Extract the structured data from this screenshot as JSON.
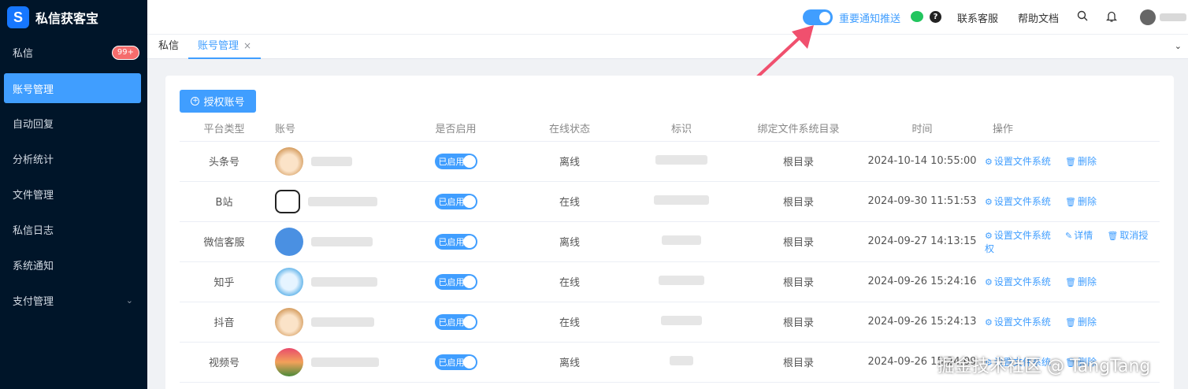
{
  "brand": {
    "name": "私信获客宝",
    "logo": "S"
  },
  "sidebar": {
    "items": [
      {
        "label": "私信",
        "badge": "99+"
      },
      {
        "label": "账号管理",
        "active": true
      },
      {
        "label": "自动回复"
      },
      {
        "label": "分析统计"
      },
      {
        "label": "文件管理"
      },
      {
        "label": "私信日志"
      },
      {
        "label": "系统通知"
      },
      {
        "label": "支付管理",
        "expandable": true
      }
    ]
  },
  "header": {
    "notify_label": "重要通知推送",
    "notify_on": true,
    "help_glyph": "?",
    "contact_label": "联系客服",
    "docs_label": "帮助文档"
  },
  "tabs": {
    "items": [
      {
        "label": "私信"
      },
      {
        "label": "账号管理",
        "active": true,
        "close": "×"
      }
    ]
  },
  "toolbar": {
    "auth_label": "授权账号",
    "auth_icon": "+"
  },
  "table": {
    "columns": [
      "平台类型",
      "账号",
      "是否启用",
      "在线状态",
      "标识",
      "绑定文件系统目录",
      "时间",
      "操作"
    ],
    "enabled_label": "已启用",
    "rows": [
      {
        "platform": "头条号",
        "status": "离线",
        "dir": "根目录",
        "time": "2024-10-14 10:55:00",
        "actions": [
          "设置文件系统",
          "删除"
        ]
      },
      {
        "platform": "B站",
        "status": "在线",
        "dir": "根目录",
        "time": "2024-09-30 11:51:53",
        "actions": [
          "设置文件系统",
          "删除"
        ]
      },
      {
        "platform": "微信客服",
        "status": "离线",
        "dir": "根目录",
        "time": "2024-09-27 14:13:15",
        "actions": [
          "设置文件系统",
          "详情",
          "取消授权"
        ]
      },
      {
        "platform": "知乎",
        "status": "在线",
        "dir": "根目录",
        "time": "2024-09-26 15:24:16",
        "actions": [
          "设置文件系统",
          "删除"
        ]
      },
      {
        "platform": "抖音",
        "status": "在线",
        "dir": "根目录",
        "time": "2024-09-26 15:24:13",
        "actions": [
          "设置文件系统",
          "删除"
        ]
      },
      {
        "platform": "视频号",
        "status": "离线",
        "dir": "根目录",
        "time": "2024-09-26 15:24:09",
        "actions": [
          "设置文件系统",
          "删除"
        ]
      }
    ]
  },
  "watermark": "掘金技术社区 @ TangTang",
  "colors": {
    "accent": "#409eff",
    "sidebar_bg": "#001529",
    "badge": "#f56c6c",
    "arrow": "#f0506e"
  }
}
